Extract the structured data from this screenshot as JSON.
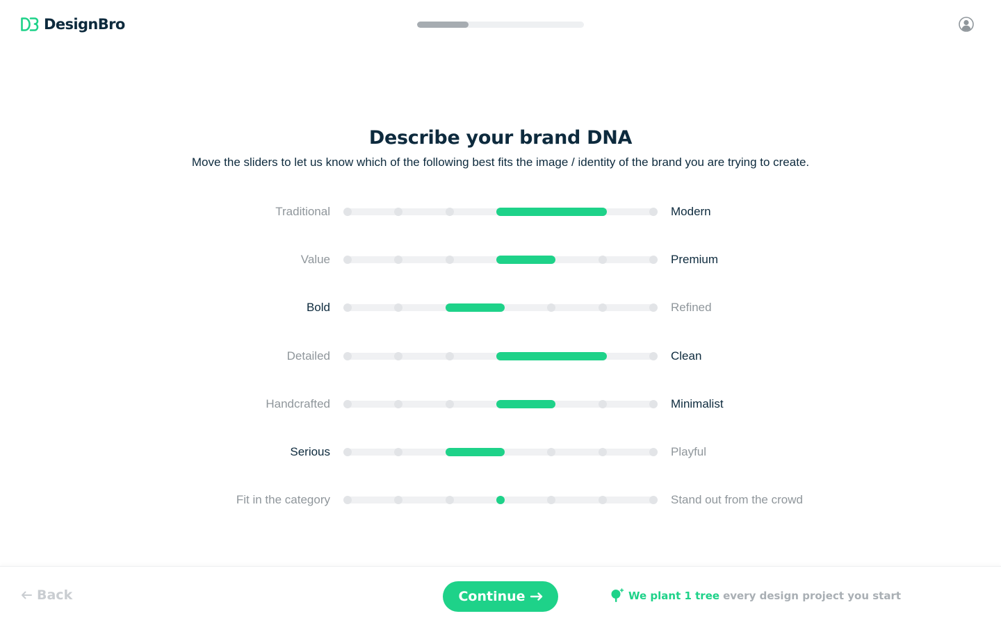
{
  "header": {
    "brand_name": "DesignBro",
    "progress_percent": 31,
    "profile_icon": "user-avatar-icon"
  },
  "main": {
    "title": "Describe your brand DNA",
    "subtitle": "Move the sliders to let us know which of the following best fits the image / identity of the brand you are trying to create.",
    "sliders": [
      {
        "left": "Traditional",
        "right": "Modern",
        "from": 3,
        "to": 5,
        "active_side": "right"
      },
      {
        "left": "Value",
        "right": "Premium",
        "from": 3,
        "to": 4,
        "active_side": "right"
      },
      {
        "left": "Bold",
        "right": "Refined",
        "from": 2,
        "to": 3,
        "active_side": "left"
      },
      {
        "left": "Detailed",
        "right": "Clean",
        "from": 3,
        "to": 5,
        "active_side": "right"
      },
      {
        "left": "Handcrafted",
        "right": "Minimalist",
        "from": 3,
        "to": 4,
        "active_side": "right"
      },
      {
        "left": "Serious",
        "right": "Playful",
        "from": 2,
        "to": 3,
        "active_side": "left"
      },
      {
        "left": "Fit in the category",
        "right": "Stand out from the crowd",
        "from": 3,
        "to": 3,
        "active_side": "none"
      }
    ],
    "slider_steps": 7
  },
  "footer": {
    "back_label": "Back",
    "continue_label": "Continue",
    "tree_highlight": "We plant 1 tree",
    "tree_rest": "every design project you start"
  },
  "colors": {
    "accent": "#1ed289",
    "text_dark": "#0d2a3d",
    "text_muted": "#8f969b"
  }
}
